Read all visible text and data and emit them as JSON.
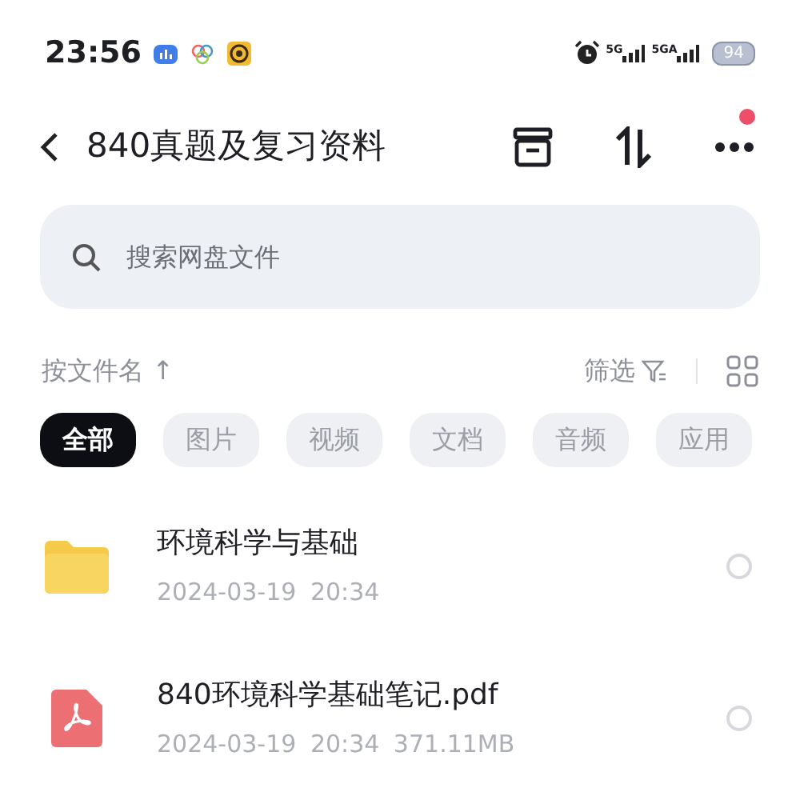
{
  "status_bar": {
    "time": "23:56",
    "network_1": "5G",
    "network_2": "5GA",
    "battery": "94"
  },
  "header": {
    "title": "840真题及复习资料",
    "notification_dot": true
  },
  "search": {
    "placeholder": "搜索网盘文件"
  },
  "sort": {
    "label": "按文件名",
    "direction_arrow": "↑",
    "filter": "筛选"
  },
  "chips": [
    {
      "label": "全部",
      "selected": true
    },
    {
      "label": "图片",
      "selected": false
    },
    {
      "label": "视频",
      "selected": false
    },
    {
      "label": "文档",
      "selected": false
    },
    {
      "label": "音频",
      "selected": false
    },
    {
      "label": "应用",
      "selected": false
    }
  ],
  "files": [
    {
      "kind": "folder",
      "name": "环境科学与基础",
      "date": "2024-03-19",
      "time": "20:34",
      "selected": false
    },
    {
      "kind": "pdf",
      "name": "840环境科学基础笔记.pdf",
      "date": "2024-03-19",
      "time": "20:34",
      "size": "371.11MB",
      "selected": false
    }
  ]
}
